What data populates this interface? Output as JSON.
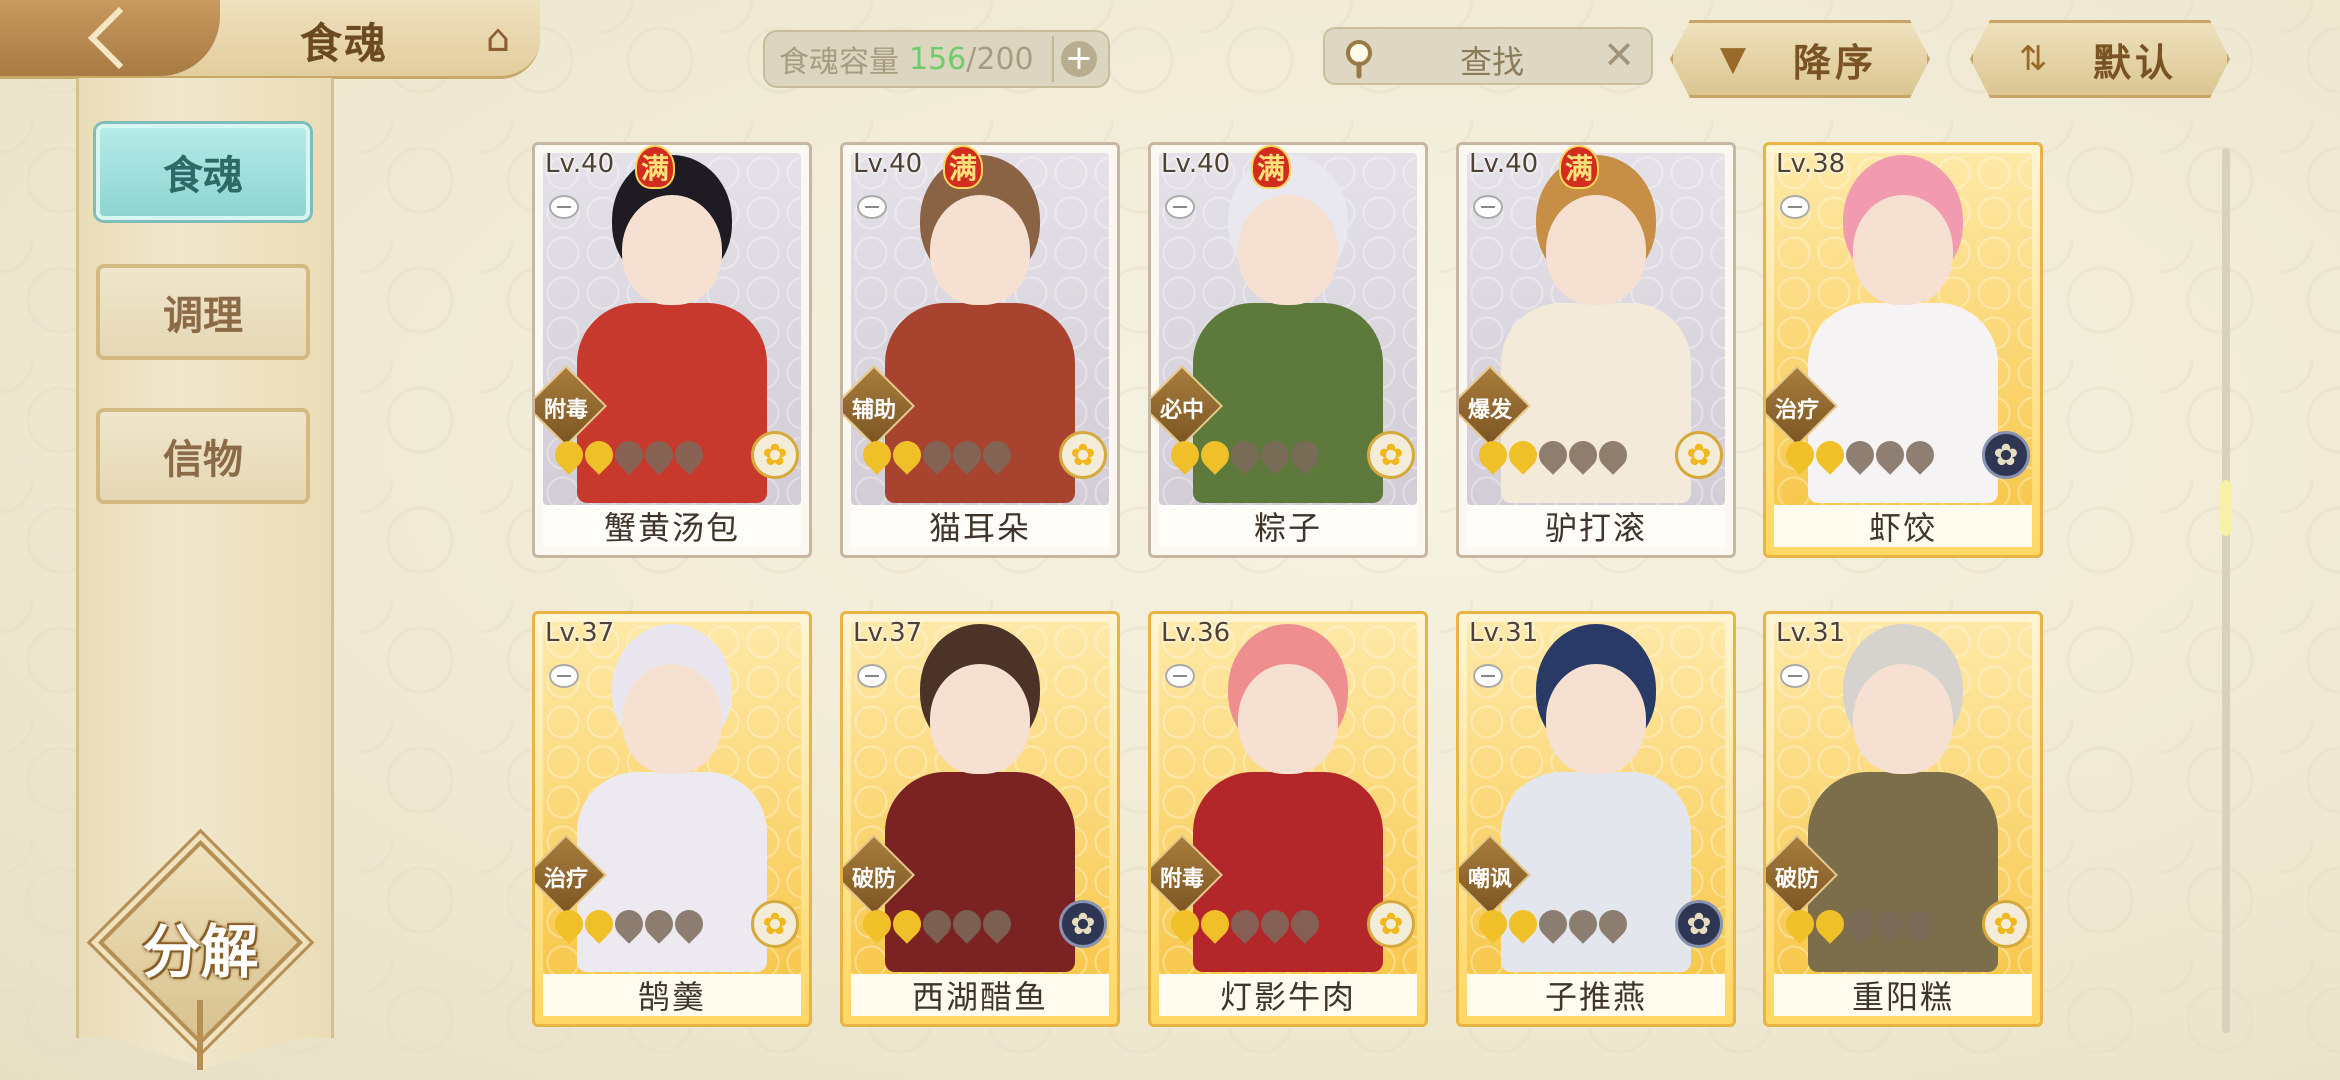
{
  "header": {
    "back_icon": "back-arrow-icon",
    "title": "食魂",
    "hall_icon": "pavilion-icon",
    "capacity": {
      "label": "食魂容量",
      "current": "156",
      "max": "/200",
      "plus": "+"
    },
    "search": {
      "placeholder": "查找",
      "clear": "✕"
    },
    "sort_desc": {
      "label": "降序",
      "icon": "▼"
    },
    "sort_default": {
      "label": "默认",
      "icon": "⇅"
    }
  },
  "sidebar": {
    "tabs": [
      {
        "label": "食魂",
        "active": true
      },
      {
        "label": "调理",
        "active": false
      },
      {
        "label": "信物",
        "active": false
      }
    ],
    "split_button": "分解"
  },
  "colors": {
    "accent_teal": "#8ed4d1",
    "gold": "#f0c029",
    "capacity_green": "#6fcc6a",
    "full_badge_red": "#d22b1f"
  },
  "cards": [
    {
      "level": "Lv.40",
      "full": "满",
      "role": "附毒",
      "stars": 2,
      "emblem": "gold",
      "name": "蟹黄汤包",
      "frame": "silver"
    },
    {
      "level": "Lv.40",
      "full": "满",
      "role": "辅助",
      "stars": 2,
      "emblem": "gold",
      "name": "猫耳朵",
      "frame": "silver"
    },
    {
      "level": "Lv.40",
      "full": "满",
      "role": "必中",
      "stars": 2,
      "emblem": "gold",
      "name": "粽子",
      "frame": "silver"
    },
    {
      "level": "Lv.40",
      "full": "满",
      "role": "爆发",
      "stars": 2,
      "emblem": "gold",
      "name": "驴打滚",
      "frame": "silver"
    },
    {
      "level": "Lv.38",
      "full": "",
      "role": "治疗",
      "stars": 2,
      "emblem": "dark",
      "name": "虾饺",
      "frame": "gold"
    },
    {
      "level": "Lv.37",
      "full": "",
      "role": "治疗",
      "stars": 2,
      "emblem": "gold",
      "name": "鹄羹",
      "frame": "gold"
    },
    {
      "level": "Lv.37",
      "full": "",
      "role": "破防",
      "stars": 2,
      "emblem": "dark",
      "name": "西湖醋鱼",
      "frame": "gold"
    },
    {
      "level": "Lv.36",
      "full": "",
      "role": "附毒",
      "stars": 2,
      "emblem": "gold",
      "name": "灯影牛肉",
      "frame": "gold"
    },
    {
      "level": "Lv.31",
      "full": "",
      "role": "嘲讽",
      "stars": 2,
      "emblem": "dark",
      "name": "子推燕",
      "frame": "gold"
    },
    {
      "level": "Lv.31",
      "full": "",
      "role": "破防",
      "stars": 2,
      "emblem": "gold",
      "name": "重阳糕",
      "frame": "gold"
    }
  ]
}
